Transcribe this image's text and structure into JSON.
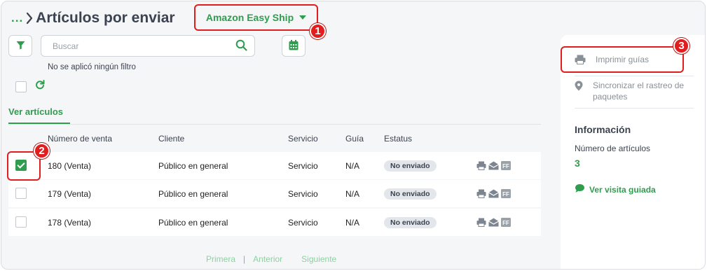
{
  "header": {
    "breadcrumb_dots": "...",
    "title": "Artículos por enviar",
    "channel": "Amazon Easy Ship"
  },
  "toolbar": {
    "search_placeholder": "Buscar",
    "no_filter_text": "No se aplicó ningún filtro"
  },
  "tabs": [
    {
      "label": "Ver artículos",
      "active": true
    }
  ],
  "table": {
    "columns": [
      "Número de venta",
      "Cliente",
      "Servicio",
      "Guía",
      "Estatus"
    ],
    "rows": [
      {
        "checked": true,
        "sale": "180 (Venta)",
        "client": "Público en general",
        "service": "Servicio",
        "guide": "N/A",
        "status": "No enviado"
      },
      {
        "checked": false,
        "sale": "179 (Venta)",
        "client": "Público en general",
        "service": "Servicio",
        "guide": "N/A",
        "status": "No enviado"
      },
      {
        "checked": false,
        "sale": "178 (Venta)",
        "client": "Público en general",
        "service": "Servicio",
        "guide": "N/A",
        "status": "No enviado"
      }
    ],
    "row_action_icons": [
      "printer-icon",
      "envelope-icon",
      "ff-icon"
    ]
  },
  "pagination": {
    "first": "Primera",
    "separator": "|",
    "prev": "Anterior",
    "next": "Siguiente"
  },
  "sidebar": {
    "print_label": "Imprimir guías",
    "sync_label": "Sincronizar el rastreo de paquetes",
    "info_title": "Información",
    "count_label": "Número de artículos",
    "count_value": "3",
    "guide_link": "Ver visita guiada"
  },
  "annotations": {
    "badge1": "1",
    "badge2": "2",
    "badge3": "3"
  },
  "colors": {
    "accent": "#2e9d4e",
    "highlight": "#e11d1d",
    "text": "#3b4350",
    "status_bg": "#e3e6ea"
  }
}
